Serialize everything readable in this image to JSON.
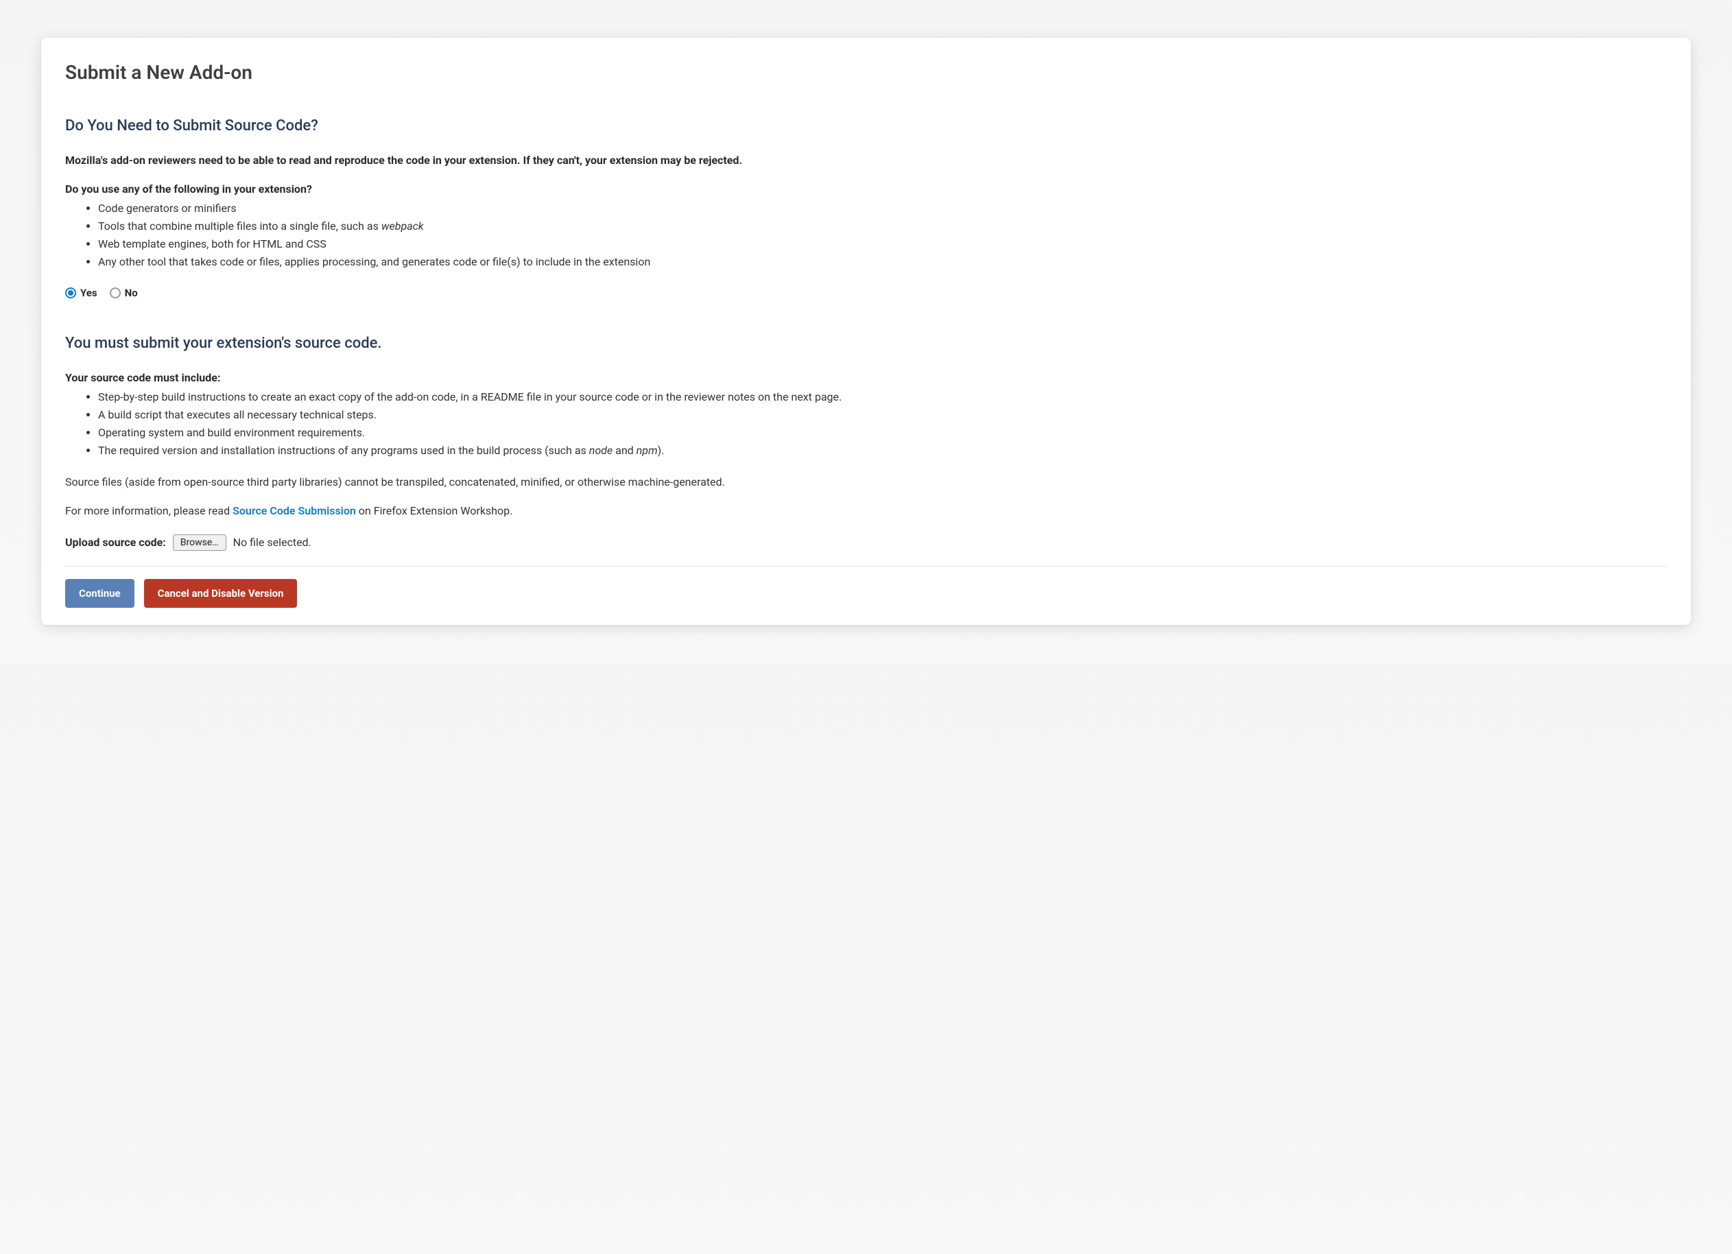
{
  "page_title": "Submit a New Add-on",
  "section1": {
    "heading": "Do You Need to Submit Source Code?",
    "intro": "Mozilla's add-on reviewers need to be able to read and reproduce the code in your extension. If they can't, your extension may be rejected.",
    "question": "Do you use any of the following in your extension?",
    "items": {
      "item1": "Code generators or minifiers",
      "item2_pre": "Tools that combine multiple files into a single file, such as ",
      "item2_em": "webpack",
      "item3": "Web template engines, both for HTML and CSS",
      "item4": "Any other tool that takes code or files, applies processing, and generates code or file(s) to include in the extension"
    }
  },
  "radio": {
    "yes": "Yes",
    "no": "No",
    "selected": "yes"
  },
  "section2": {
    "heading": "You must submit your extension's source code.",
    "must_include": "Your source code must include:",
    "items": {
      "item1": "Step-by-step build instructions to create an exact copy of the add-on code, in a README file in your source code or in the reviewer notes on the next page.",
      "item2": "A build script that executes all necessary technical steps.",
      "item3": "Operating system and build environment requirements.",
      "item4_pre": "The required version and installation instructions of any programs used in the build process (such as ",
      "item4_em1": "node",
      "item4_mid": " and ",
      "item4_em2": "npm",
      "item4_post": ")."
    },
    "note": "Source files (aside from open-source third party libraries) cannot be transpiled, concatenated, minified, or otherwise machine-generated.",
    "more_info_pre": "For more information, please read ",
    "more_info_link": "Source Code Submission",
    "more_info_post": " on Firefox Extension Workshop."
  },
  "upload": {
    "label": "Upload source code:",
    "browse_label": "Browse…",
    "status": "No file selected."
  },
  "buttons": {
    "continue": "Continue",
    "cancel": "Cancel and Disable Version"
  }
}
